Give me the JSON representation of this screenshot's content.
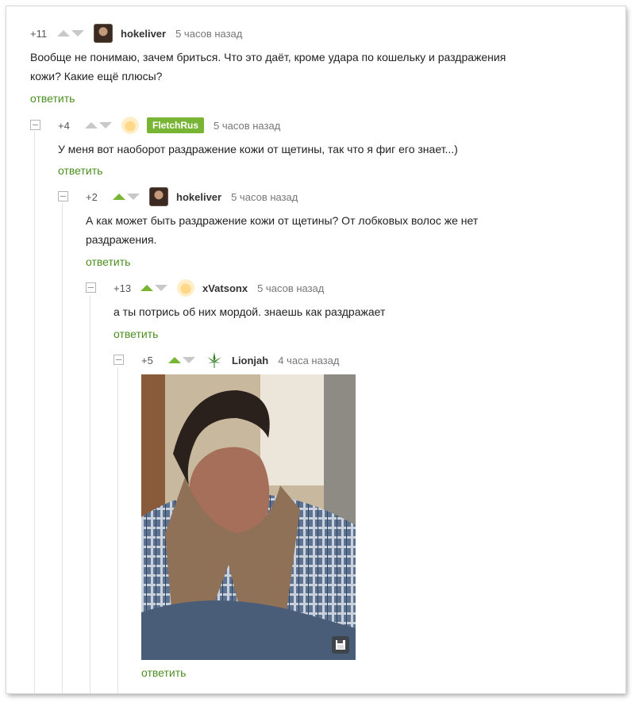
{
  "comments": [
    {
      "rating": "+11",
      "username": "hokeliver",
      "time": "5 часов назад",
      "lines": [
        "Вообще не понимаю, зачем бриться. Что это даёт, кроме удара по кошельку и раздражения",
        "кожи? Какие ещё плюсы?"
      ],
      "reply": "ответить"
    },
    {
      "rating": "+4",
      "username": "FletchRus",
      "time": "5 часов назад",
      "lines": [
        "У меня вот наоборот раздражение кожи от щетины, так что я фиг его знает...)"
      ],
      "reply": "ответить"
    },
    {
      "rating": "+2",
      "username": "hokeliver",
      "time": "5 часов назад",
      "lines": [
        "А как может быть раздражение кожи от щетины? От лобковых волос же нет",
        "раздражения."
      ],
      "reply": "ответить"
    },
    {
      "rating": "+13",
      "username": "xVatsonx",
      "time": "5 часов назад",
      "lines": [
        "а ты потрись об них мордой. знаешь как раздражает"
      ],
      "reply": "ответить"
    },
    {
      "rating": "+5",
      "username": "Lionjah",
      "time": "4 часа назад",
      "reply": "ответить",
      "media": "animated image of a man in a plaid shirt and a brown knitted scarf, with a save icon"
    }
  ],
  "icons": {
    "upvote": "triangle-up-icon",
    "downvote": "triangle-down-icon",
    "collapse": "minus-square-icon",
    "save": "floppy-disk-icon",
    "avatar_leaf": "cannabis-leaf-icon"
  },
  "colors": {
    "accent_green": "#79b535",
    "reply_link": "#4a8f1f",
    "muted_arrow": "#c8c8c8"
  }
}
